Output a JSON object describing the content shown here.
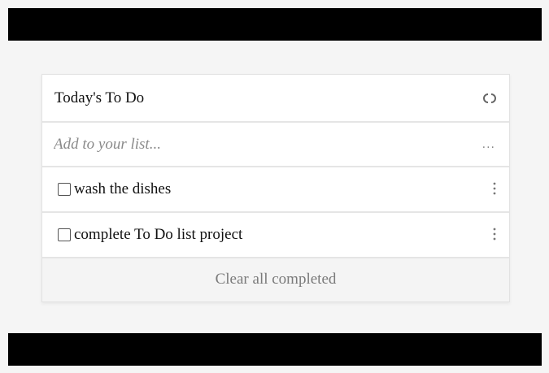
{
  "colors": {
    "background": "#f5f5f5",
    "bars": "#000000",
    "card": "#ffffff",
    "muted_text": "#7a7a7a"
  },
  "todo": {
    "title": "Today's To Do",
    "refresh_icon": "refresh-icon",
    "add_placeholder": "Add to your list...",
    "add_more_label": "...",
    "items": [
      {
        "label": "wash the dishes",
        "checked": false,
        "menu_icon": "kebab-menu-icon"
      },
      {
        "label": "complete To Do list project",
        "checked": false,
        "menu_icon": "kebab-menu-icon"
      }
    ],
    "clear_label": "Clear all completed"
  }
}
